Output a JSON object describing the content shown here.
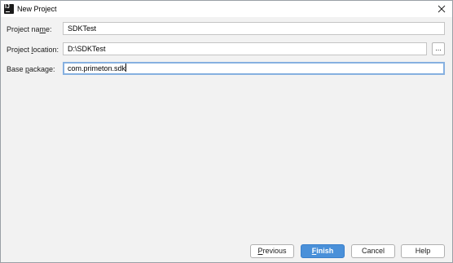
{
  "window": {
    "title": "New Project",
    "app_icon": "intellij-idea-icon",
    "close_icon": "close-icon"
  },
  "form": {
    "project_name": {
      "label_before": "Project na",
      "label_mnemonic": "m",
      "label_after": "e:",
      "value": "SDKTest"
    },
    "project_location": {
      "label_before": "Project ",
      "label_mnemonic": "l",
      "label_after": "ocation:",
      "value": "D:\\SDKTest",
      "browse_label": "..."
    },
    "base_package": {
      "label_before": "Base ",
      "label_mnemonic": "p",
      "label_after": "ackage:",
      "value": "com.primeton.sdk"
    }
  },
  "buttons": {
    "previous": {
      "mnemonic": "P",
      "rest": "revious"
    },
    "finish": {
      "mnemonic": "F",
      "rest": "inish"
    },
    "cancel": "Cancel",
    "help": "Help"
  },
  "colors": {
    "primary_button": "#4a90d9",
    "focus_border": "#86b0e0",
    "dialog_background": "#f2f2f2"
  }
}
